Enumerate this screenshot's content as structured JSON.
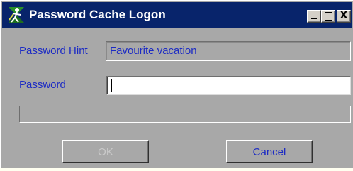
{
  "window": {
    "title": "Password Cache Logon",
    "icon": "key-person-icon",
    "controls": {
      "minimize": "minimize-icon",
      "maximize": "maximize-icon",
      "close_glyph": "X"
    }
  },
  "form": {
    "hint_label": "Password Hint",
    "hint_value": "Favourite vacation",
    "password_label": "Password",
    "password_value": ""
  },
  "buttons": {
    "ok": "OK",
    "cancel": "Cancel"
  },
  "colors": {
    "title_bar": "#08246b",
    "text_accent": "#1c2bc4",
    "dialog_bg": "#a8a8a8",
    "disabled_text": "#c9c9c9"
  }
}
